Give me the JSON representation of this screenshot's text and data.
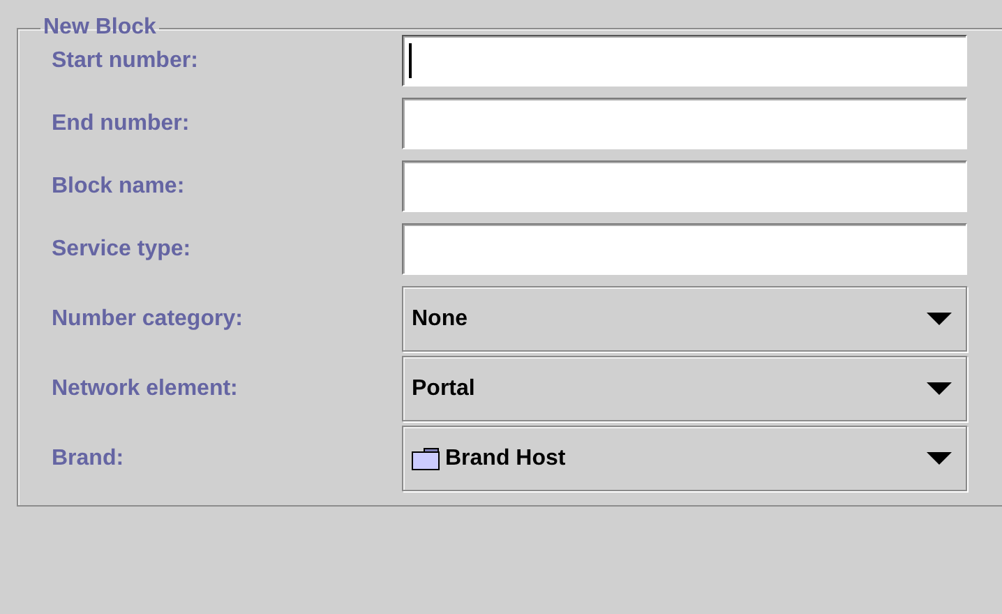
{
  "group": {
    "title": "New Block"
  },
  "fields": [
    {
      "label": "Start number:",
      "kind": "text",
      "focused": true
    },
    {
      "label": "End number:",
      "kind": "text",
      "focused": false
    },
    {
      "label": "Block name:",
      "kind": "text",
      "focused": false
    },
    {
      "label": "Service type:",
      "kind": "text",
      "focused": false
    },
    {
      "label": "Number category:",
      "kind": "select",
      "value": "None",
      "has_icon": false
    },
    {
      "label": "Network element:",
      "kind": "select",
      "value": "Portal",
      "has_icon": false
    },
    {
      "label": "Brand:",
      "kind": "select",
      "value": "Brand Host",
      "has_icon": true
    }
  ]
}
